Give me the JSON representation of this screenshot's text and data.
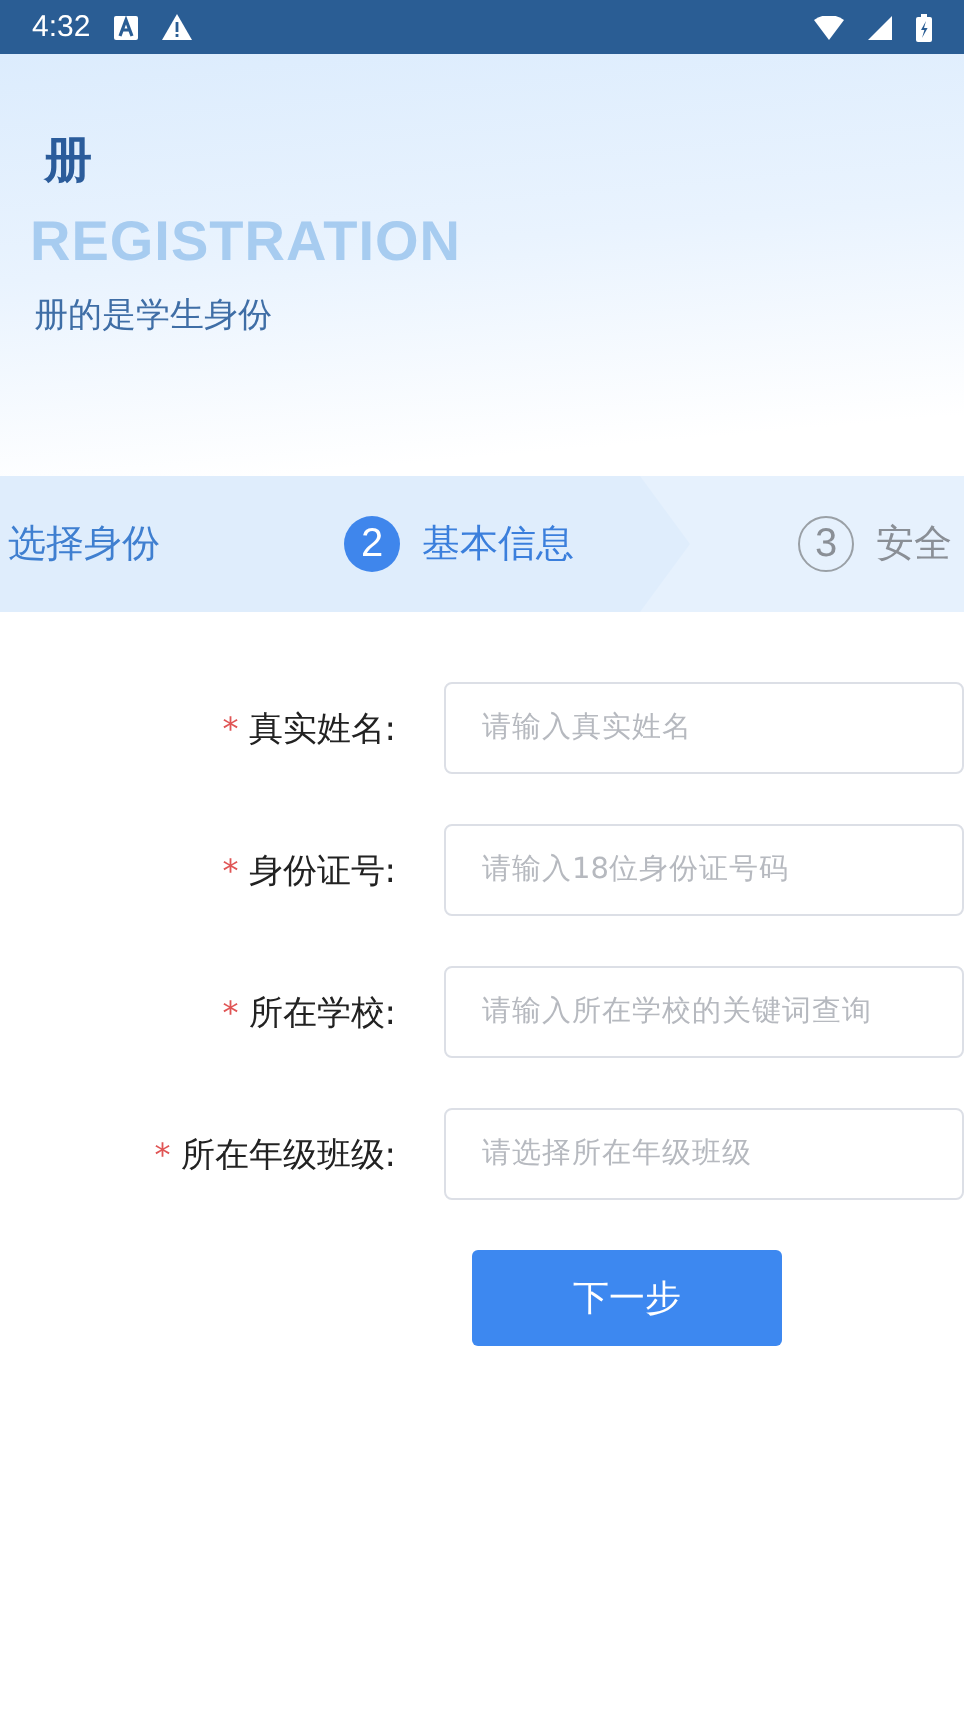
{
  "status_bar": {
    "time": "4:32"
  },
  "header": {
    "title": "册",
    "subtitle_en": "REGISTRATION",
    "note": "册的是学生身份"
  },
  "steps": [
    {
      "label": "选择身份",
      "selected": false,
      "completed": true
    },
    {
      "number": "2",
      "label": "基本信息",
      "selected": true,
      "completed": false
    },
    {
      "number": "3",
      "label": "安全",
      "selected": false,
      "completed": false
    }
  ],
  "fields": [
    {
      "marker": "*",
      "label": "真实姓名:",
      "placeholder": "请输入真实姓名"
    },
    {
      "marker": "*",
      "label": "身份证号:",
      "placeholder": "请输入18位身份证号码"
    },
    {
      "marker": "*",
      "label": "所在学校:",
      "placeholder": "请输入所在学校的关键词查询"
    },
    {
      "marker": "*",
      "label": "所在年级班级:",
      "placeholder": "请选择所在年级班级"
    }
  ],
  "next_button": "下一步"
}
